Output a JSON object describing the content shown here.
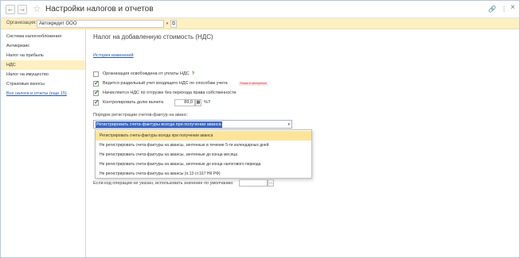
{
  "window": {
    "title": "Настройки налогов и отчетов",
    "back_icon": "←",
    "forward_icon": "→",
    "star_icon": "☆",
    "link_icon": "🔗",
    "more_icon": "⋮",
    "close_icon": "×"
  },
  "organization": {
    "label": "Организация:",
    "value": "Автокредит ООО",
    "dropdown_icon": "▾",
    "open_icon": "⧉"
  },
  "sidebar": {
    "items": [
      {
        "label": "Система налогообложения"
      },
      {
        "label": "Антикризис"
      },
      {
        "label": "Налог на прибыль"
      },
      {
        "label": "НДС"
      },
      {
        "label": "Налог на имущество"
      },
      {
        "label": "Страховые взносы"
      },
      {
        "label": "Все налоги и отчеты (еще 15)"
      }
    ],
    "active_index": 3
  },
  "main": {
    "heading": "Налог на добавленную стоимость (НДС)",
    "history_link": "История изменений",
    "options": [
      {
        "label": "Организация освобождена от уплаты НДС",
        "checked": false,
        "help": "?"
      },
      {
        "label": "Ведется раздельный учет входящего НДС по способам учета",
        "checked": true,
        "badge": "Только в экспортные"
      },
      {
        "label": "Начисляется НДС по отгрузке без перехода права собственности",
        "checked": true
      },
      {
        "label": "Контролировать долю вычета",
        "checked": true,
        "value": "89,0",
        "calc_icon": "▦",
        "unit": "%",
        "help": "?"
      }
    ],
    "invoice_order": {
      "label": "Порядок регистрации счетов-фактур на аванс:",
      "selected": "Регистрировать счета-фактуры всегда при получении аванса",
      "arrow_icon": "▾",
      "dropdown_options": [
        "Регистрировать счета-фактуры всегда при получении аванса",
        "Не регистрировать счета-фактуры на авансы, зачтенные в течение 5-ти календарных дней",
        "Не регистрировать счета-фактуры на авансы, зачтенные до конца месяца",
        "Не регистрировать счета-фактуры на авансы, зачтенные до конца налогового периода",
        "Не регистрировать счета-фактуры на авансы (п.13 ст.167 НК РФ)"
      ],
      "dropdown_selected_index": 0
    },
    "default_code": {
      "label": "Если код операции не указан, использовать значение по умолчанию:",
      "value": "",
      "button_icon": "..."
    }
  }
}
